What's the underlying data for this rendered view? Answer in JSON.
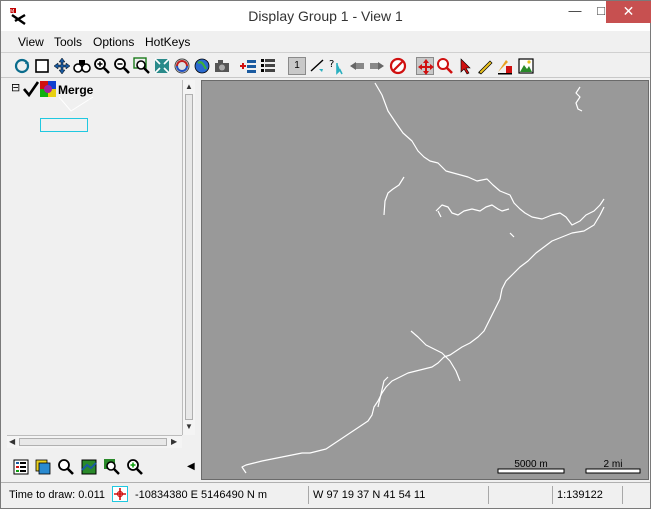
{
  "window": {
    "title": "Display Group 1 - View 1",
    "minimize": "—",
    "maximize": "□",
    "close": "✕"
  },
  "menu": {
    "items": [
      "View",
      "Tools",
      "Options",
      "HotKeys"
    ]
  },
  "toolbar": {
    "icons": [
      "redraw-icon",
      "full-view-icon",
      "pan-icon",
      "zoom-binoculars-icon",
      "zoom-in-icon",
      "zoom-out-icon",
      "zoom-box-icon",
      "zoom-fit-icon",
      "sync-icon",
      "globe-icon",
      "snapshot-icon",
      "add-layer-icon",
      "layer-list-icon",
      "one-to-one-icon",
      "measure-icon",
      "query-icon",
      "previous-view-icon",
      "next-view-icon",
      "stop-icon",
      "move-cursor-icon",
      "zoom-circle-icon",
      "select-arrow-icon",
      "pencil-icon",
      "legend-icon",
      "image-icon"
    ],
    "one_to_one_label": "1"
  },
  "layers": {
    "root_toggle": "⊟",
    "group_name": "Merge",
    "checked": true
  },
  "bottom_tools": {
    "icons": [
      "legend-list-icon",
      "layers-icon",
      "search-icon",
      "map-icon",
      "zoom-map-icon",
      "zoom-plus-icon"
    ],
    "collapse": "◀"
  },
  "map": {
    "background": "#999999",
    "line_color": "#ffffff",
    "scale_bars": [
      {
        "label": "5000 m"
      },
      {
        "label": "2 mi"
      }
    ]
  },
  "status": {
    "time_to_draw": "Time to draw: 0.011",
    "xy": "-10834380 E  5146490 N m",
    "latlon": "W 97 19 37  N 41 54 11",
    "blank": "",
    "scale": "1:139122"
  }
}
